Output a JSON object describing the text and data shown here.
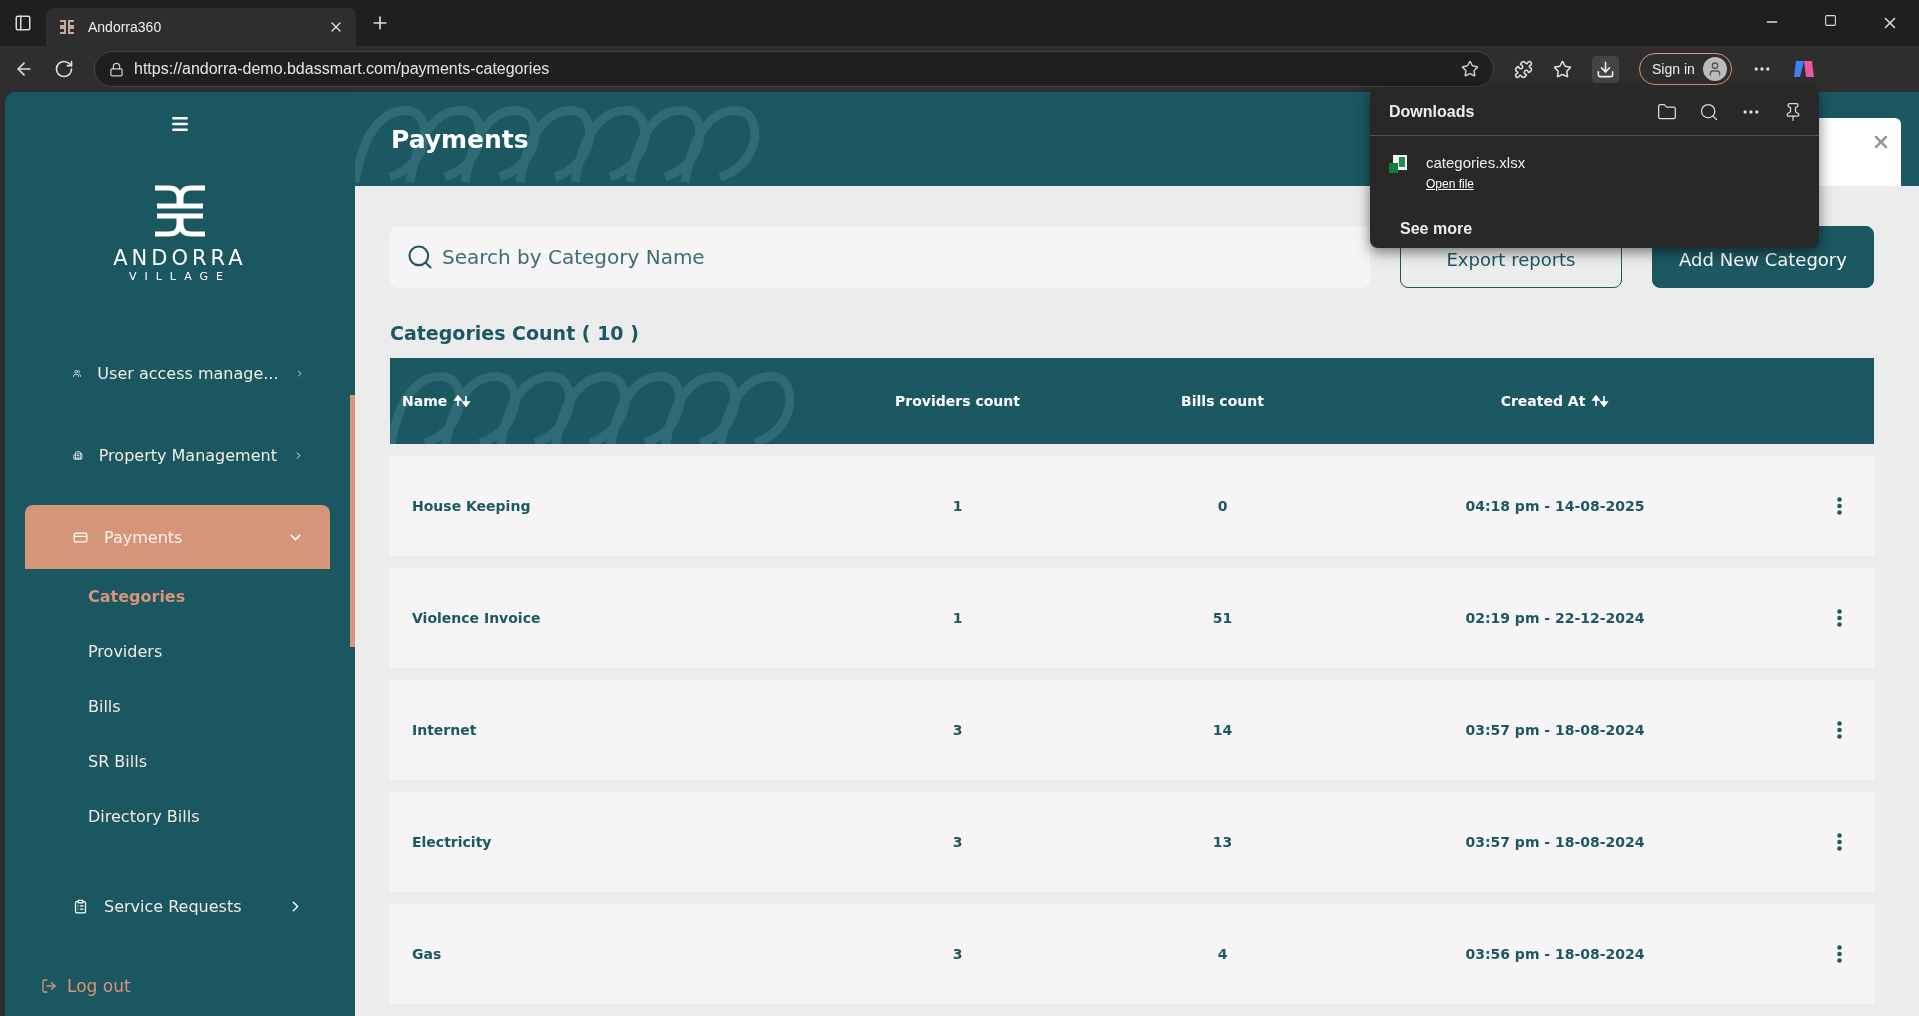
{
  "browser": {
    "tab_title": "Andorra360",
    "url": "https://andorra-demo.bdassmart.com/payments-categories",
    "sign_in": "Sign in"
  },
  "sidebar": {
    "brand": "ANDORRA",
    "brand_sub": "VILLAGE",
    "items": [
      {
        "label": "User access manage...",
        "expanded": false,
        "selected": false
      },
      {
        "label": "Property Management",
        "expanded": false,
        "selected": false
      },
      {
        "label": "Payments",
        "expanded": true,
        "selected": true,
        "children": [
          {
            "label": "Categories",
            "selected": true
          },
          {
            "label": "Providers",
            "selected": false
          },
          {
            "label": "Bills",
            "selected": false
          },
          {
            "label": "SR Bills",
            "selected": false
          },
          {
            "label": "Directory Bills",
            "selected": false
          }
        ]
      },
      {
        "label": "Service Requests",
        "expanded": false,
        "selected": false
      }
    ],
    "logout": "Log out"
  },
  "header": {
    "title": "Payments"
  },
  "search": {
    "placeholder": "Search by Category Name"
  },
  "buttons": [
    {
      "label": "Export reports",
      "kind": "outline"
    },
    {
      "label": "Add New Category",
      "kind": "filled"
    }
  ],
  "count_label": "Categories Count ( 10 )",
  "table": {
    "columns": [
      {
        "label": "Name",
        "sortable": true
      },
      {
        "label": "Providers count",
        "sortable": false
      },
      {
        "label": "Bills count",
        "sortable": false
      },
      {
        "label": "Created At",
        "sortable": true
      }
    ],
    "rows": [
      [
        "House Keeping",
        "1",
        "0",
        "04:18 pm - 14-08-2025"
      ],
      [
        "Violence Invoice",
        "1",
        "51",
        "02:19 pm - 22-12-2024"
      ],
      [
        "Internet",
        "3",
        "14",
        "03:57 pm - 18-08-2024"
      ],
      [
        "Electricity",
        "3",
        "13",
        "03:57 pm - 18-08-2024"
      ],
      [
        "Gas",
        "3",
        "4",
        "03:56 pm - 18-08-2024"
      ]
    ]
  },
  "downloads": {
    "title": "Downloads",
    "file_name": "categories.xlsx",
    "open_link": "Open file",
    "see_more": "See more"
  }
}
